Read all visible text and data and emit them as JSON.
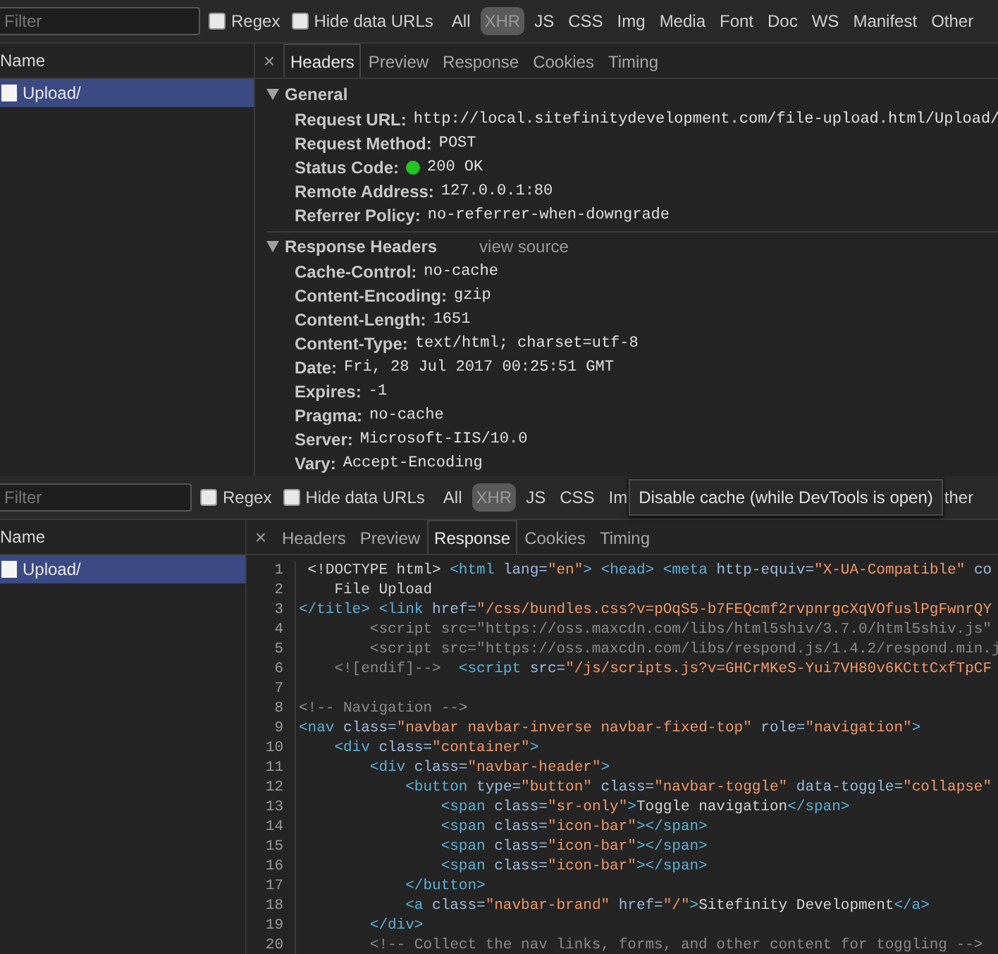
{
  "panels": [
    {
      "filter": {
        "placeholder": "Filter"
      },
      "regex": {
        "label": "Regex",
        "checked": false
      },
      "hide_data_urls": {
        "label": "Hide data URLs",
        "checked": false
      },
      "types": [
        {
          "label": "All",
          "selected": false
        },
        {
          "label": "XHR",
          "selected": true
        },
        {
          "label": "JS",
          "selected": false
        },
        {
          "label": "CSS",
          "selected": false
        },
        {
          "label": "Img",
          "selected": false
        },
        {
          "label": "Media",
          "selected": false
        },
        {
          "label": "Font",
          "selected": false
        },
        {
          "label": "Doc",
          "selected": false
        },
        {
          "label": "WS",
          "selected": false
        },
        {
          "label": "Manifest",
          "selected": false
        },
        {
          "label": "Other",
          "selected": false
        }
      ],
      "name_column": "Name",
      "requests": [
        {
          "name": "Upload/",
          "selected": true
        }
      ],
      "close": "×",
      "tabs": [
        {
          "label": "Headers",
          "selected": true
        },
        {
          "label": "Preview",
          "selected": false
        },
        {
          "label": "Response",
          "selected": false
        },
        {
          "label": "Cookies",
          "selected": false
        },
        {
          "label": "Timing",
          "selected": false
        }
      ],
      "content": {
        "kind": "headers",
        "sections": [
          {
            "title": "General",
            "expanded": true,
            "rows": [
              {
                "key": "Request URL:",
                "value": "http://local.sitefinitydevelopment.com/file-upload.html/Upload/"
              },
              {
                "key": "Request Method:",
                "value": "POST"
              },
              {
                "key": "Status Code:",
                "value": "200 OK",
                "kind": "status"
              },
              {
                "key": "Remote Address:",
                "value": "127.0.0.1:80"
              },
              {
                "key": "Referrer Policy:",
                "value": "no-referrer-when-downgrade"
              }
            ]
          },
          {
            "title": "Response Headers",
            "expanded": true,
            "link": "view source",
            "rows": [
              {
                "key": "Cache-Control:",
                "value": "no-cache"
              },
              {
                "key": "Content-Encoding:",
                "value": "gzip"
              },
              {
                "key": "Content-Length:",
                "value": "1651"
              },
              {
                "key": "Content-Type:",
                "value": "text/html; charset=utf-8"
              },
              {
                "key": "Date:",
                "value": "Fri, 28 Jul 2017 00:25:51 GMT"
              },
              {
                "key": "Expires:",
                "value": "-1"
              },
              {
                "key": "Pragma:",
                "value": "no-cache"
              },
              {
                "key": "Server:",
                "value": "Microsoft-IIS/10.0"
              },
              {
                "key": "Vary:",
                "value": "Accept-Encoding"
              }
            ]
          }
        ]
      }
    },
    {
      "filter": {
        "placeholder": "Filter"
      },
      "regex": {
        "label": "Regex",
        "checked": false
      },
      "hide_data_urls": {
        "label": "Hide data URLs",
        "checked": false
      },
      "types": [
        {
          "label": "All",
          "selected": false
        },
        {
          "label": "XHR",
          "selected": true
        },
        {
          "label": "JS",
          "selected": false
        },
        {
          "label": "CSS",
          "selected": false
        },
        {
          "label": "Im",
          "selected": false
        },
        {
          "label": "ther",
          "selected": false
        }
      ],
      "tooltip": "Disable cache (while DevTools is open)",
      "name_column": "Name",
      "requests": [
        {
          "name": "Upload/",
          "selected": true
        }
      ],
      "close": "×",
      "tabs": [
        {
          "label": "Headers",
          "selected": false
        },
        {
          "label": "Preview",
          "selected": false
        },
        {
          "label": "Response",
          "selected": true
        },
        {
          "label": "Cookies",
          "selected": false
        },
        {
          "label": "Timing",
          "selected": false
        }
      ],
      "content": {
        "kind": "response",
        "lines": [
          {
            "number": "1",
            "tokens": [
              {
                "kind": "text",
                "text": " <!DOCTYPE html> "
              },
              {
                "kind": "tag",
                "text": "<html"
              },
              {
                "kind": "attr",
                "text": " lang="
              },
              {
                "kind": "value",
                "text": "\"en\""
              },
              {
                "kind": "tag",
                "text": ">"
              },
              {
                "kind": "tag",
                "text": " <head>"
              },
              {
                "kind": "tag",
                "text": " <meta"
              },
              {
                "kind": "attr",
                "text": " http-equiv="
              },
              {
                "kind": "value",
                "text": "\"X-UA-Compatible\""
              },
              {
                "kind": "attr",
                "text": " co"
              }
            ]
          },
          {
            "number": "2",
            "tokens": [
              {
                "kind": "text",
                "text": "    File Upload"
              }
            ]
          },
          {
            "number": "3",
            "tokens": [
              {
                "kind": "tag",
                "text": "</title>"
              },
              {
                "kind": "tag",
                "text": " <link"
              },
              {
                "kind": "attr",
                "text": " href="
              },
              {
                "kind": "value",
                "text": "\"/css/bundles.css?v=pOqS5-b7FEQcmf2rvpnrgcXqVOfuslPgFwnrQY"
              }
            ]
          },
          {
            "number": "4",
            "tokens": [
              {
                "kind": "comment",
                "text": "        <script src=\"https://oss.maxcdn.com/libs/html5shiv/3.7.0/html5shiv.js\""
              }
            ]
          },
          {
            "number": "5",
            "tokens": [
              {
                "kind": "comment",
                "text": "        <script src=\"https://oss.maxcdn.com/libs/respond.js/1.4.2/respond.min.j"
              }
            ]
          },
          {
            "number": "6",
            "tokens": [
              {
                "kind": "comment",
                "text": "    <![endif]-->"
              },
              {
                "kind": "tag",
                "text": "  <script"
              },
              {
                "kind": "attr",
                "text": " src="
              },
              {
                "kind": "value",
                "text": "\"/js/scripts.js?v=GHCrMKeS-Yui7VH80v6KCttCxfTpCF"
              }
            ]
          },
          {
            "number": "7"
          },
          {
            "number": "8",
            "tokens": [
              {
                "kind": "comment",
                "text": "<!-- Navigation -->"
              }
            ]
          },
          {
            "number": "9",
            "tokens": [
              {
                "kind": "tag",
                "text": "<nav"
              },
              {
                "kind": "attr",
                "text": " class="
              },
              {
                "kind": "value",
                "text": "\"navbar navbar-inverse navbar-fixed-top\""
              },
              {
                "kind": "attr",
                "text": " role="
              },
              {
                "kind": "value",
                "text": "\"navigation\""
              },
              {
                "kind": "tag",
                "text": ">"
              }
            ]
          },
          {
            "number": "10",
            "tokens": [
              {
                "kind": "tag",
                "text": "    <div"
              },
              {
                "kind": "attr",
                "text": " class="
              },
              {
                "kind": "value",
                "text": "\"container\""
              },
              {
                "kind": "tag",
                "text": ">"
              }
            ]
          },
          {
            "number": "11",
            "tokens": [
              {
                "kind": "tag",
                "text": "        <div"
              },
              {
                "kind": "attr",
                "text": " class="
              },
              {
                "kind": "value",
                "text": "\"navbar-header\""
              },
              {
                "kind": "tag",
                "text": ">"
              }
            ]
          },
          {
            "number": "12",
            "tokens": [
              {
                "kind": "tag",
                "text": "            <button"
              },
              {
                "kind": "attr",
                "text": " type="
              },
              {
                "kind": "value",
                "text": "\"button\""
              },
              {
                "kind": "attr",
                "text": " class="
              },
              {
                "kind": "value",
                "text": "\"navbar-toggle\""
              },
              {
                "kind": "attr",
                "text": " data-toggle="
              },
              {
                "kind": "value",
                "text": "\"collapse\""
              }
            ]
          },
          {
            "number": "13",
            "tokens": [
              {
                "kind": "tag",
                "text": "                <span"
              },
              {
                "kind": "attr",
                "text": " class="
              },
              {
                "kind": "value",
                "text": "\"sr-only\""
              },
              {
                "kind": "tag",
                "text": ">"
              },
              {
                "kind": "text",
                "text": "Toggle navigation"
              },
              {
                "kind": "tag",
                "text": "</span>"
              }
            ]
          },
          {
            "number": "14",
            "tokens": [
              {
                "kind": "tag",
                "text": "                <span"
              },
              {
                "kind": "attr",
                "text": " class="
              },
              {
                "kind": "value",
                "text": "\"icon-bar\""
              },
              {
                "kind": "tag",
                "text": "></span>"
              }
            ]
          },
          {
            "number": "15",
            "tokens": [
              {
                "kind": "tag",
                "text": "                <span"
              },
              {
                "kind": "attr",
                "text": " class="
              },
              {
                "kind": "value",
                "text": "\"icon-bar\""
              },
              {
                "kind": "tag",
                "text": "></span>"
              }
            ]
          },
          {
            "number": "16",
            "tokens": [
              {
                "kind": "tag",
                "text": "                <span"
              },
              {
                "kind": "attr",
                "text": " class="
              },
              {
                "kind": "value",
                "text": "\"icon-bar\""
              },
              {
                "kind": "tag",
                "text": "></span>"
              }
            ]
          },
          {
            "number": "17",
            "tokens": [
              {
                "kind": "tag",
                "text": "            </button>"
              }
            ]
          },
          {
            "number": "18",
            "tokens": [
              {
                "kind": "tag",
                "text": "            <a"
              },
              {
                "kind": "attr",
                "text": " class="
              },
              {
                "kind": "value",
                "text": "\"navbar-brand\""
              },
              {
                "kind": "attr",
                "text": " href="
              },
              {
                "kind": "value",
                "text": "\"/\""
              },
              {
                "kind": "tag",
                "text": ">"
              },
              {
                "kind": "text",
                "text": "Sitefinity Development"
              },
              {
                "kind": "tag",
                "text": "</a>"
              }
            ]
          },
          {
            "number": "19",
            "tokens": [
              {
                "kind": "tag",
                "text": "        </div>"
              }
            ]
          },
          {
            "number": "20",
            "tokens": [
              {
                "kind": "comment",
                "text": "        <!-- Collect the nav links, forms, and other content for toggling -->"
              }
            ]
          }
        ]
      }
    }
  ]
}
